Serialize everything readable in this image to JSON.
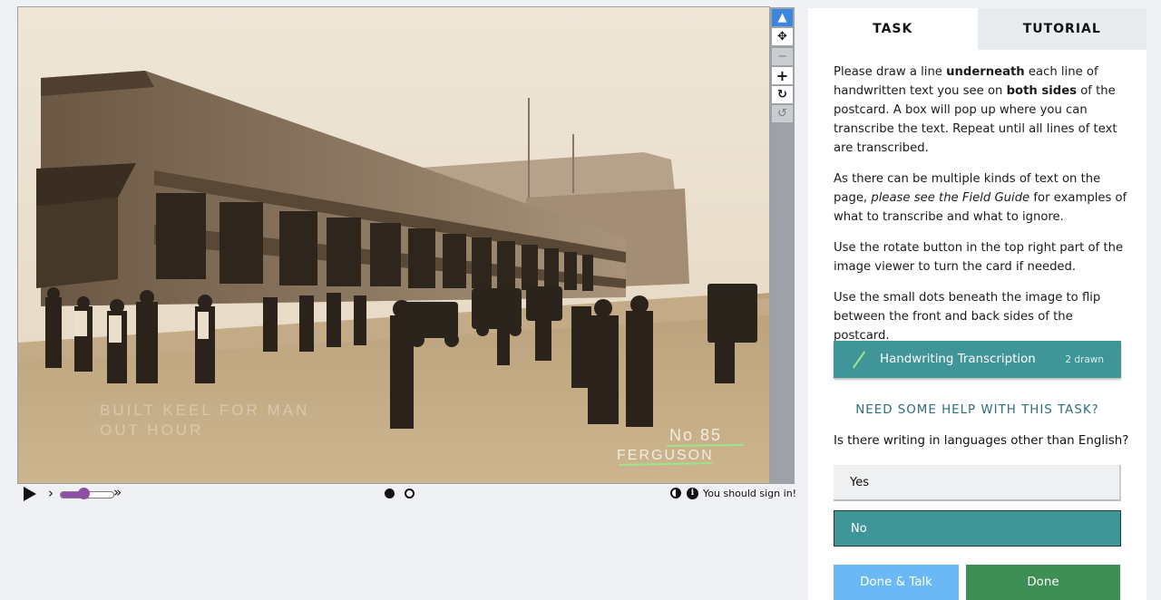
{
  "viewer": {
    "image_description_icon": "postcard-photo",
    "handwriting_lines": [
      "No 85",
      "FERGUSON"
    ],
    "faint_caption": [
      "BUILT   KEEL   FOR   MAN",
      "        OUT  HOUR"
    ]
  },
  "tools": [
    {
      "name": "pointer-icon",
      "glyph": "▲",
      "state": "active"
    },
    {
      "name": "move-icon",
      "glyph": "✥",
      "state": "normal"
    },
    {
      "name": "zoom-out-icon",
      "glyph": "−",
      "state": "disabled"
    },
    {
      "name": "zoom-in-icon",
      "glyph": "+",
      "state": "normal"
    },
    {
      "name": "rotate-icon",
      "glyph": "↻",
      "state": "normal"
    },
    {
      "name": "reset-icon",
      "glyph": "↺",
      "state": "disabled"
    }
  ],
  "controls": {
    "slow_glyph": "›",
    "fast_glyph": "»",
    "speed_level": 0.45,
    "frames_total": 2,
    "current_frame": 1,
    "info_glyph": "i",
    "signin_text": "You should sign in!"
  },
  "tabs": {
    "task": "TASK",
    "tutorial": "TUTORIAL"
  },
  "instructions": {
    "p1_a": "Please draw a line ",
    "p1_b": "underneath",
    "p1_c": " each line of handwritten text you see on ",
    "p1_d": "both sides",
    "p1_e": " of the postcard. A box will pop up where you can transcribe the text. Repeat until all lines of text are transcribed.",
    "p2_a": "As there can be multiple kinds of text on the page, ",
    "p2_b": "please see the Field Guide",
    "p2_c": " for examples of what to transcribe and what to ignore.",
    "p3": "Use the rotate button in the top right part of the image viewer to turn the card if needed.",
    "p4": "Use the small dots beneath the image to flip between the front and back sides of the postcard."
  },
  "tool_option": {
    "label": "Handwriting Transcription",
    "count": "2 drawn",
    "line_color": "#9de48c"
  },
  "help_link": "NEED SOME HELP WITH THIS TASK?",
  "question": {
    "text": "Is there writing in languages other than English?",
    "answers": [
      "Yes",
      "No"
    ],
    "selected": "No"
  },
  "buttons": {
    "done_talk": "Done & Talk",
    "done": "Done"
  },
  "colors": {
    "teal": "#3f9598",
    "done_green": "#3e8f55",
    "done_talk_blue": "#6ab9f5",
    "active_tool": "#3d86e0",
    "speed_purple": "#8e4fa8"
  }
}
